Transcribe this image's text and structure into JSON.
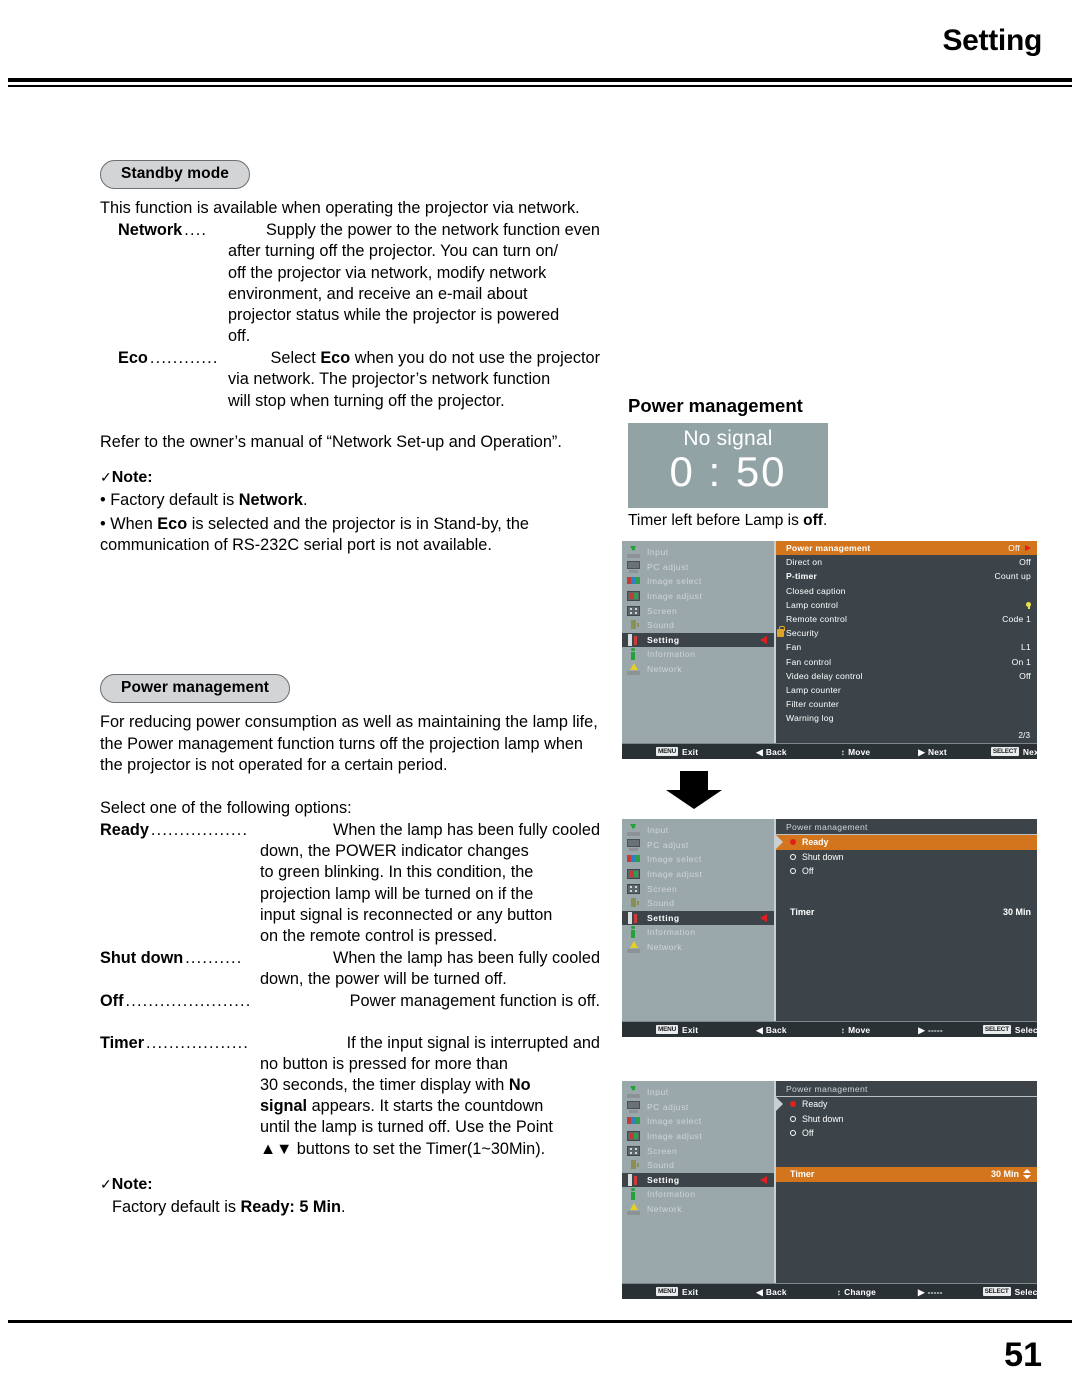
{
  "header": {
    "title": "Setting"
  },
  "footer": {
    "page_number": "51"
  },
  "left_column": {
    "standby": {
      "pill_label": "Standby mode",
      "intro": "This function is available when operating the projector via network.",
      "definitions": [
        {
          "term": "Network",
          "leader": "....",
          "lines": [
            "Supply the power to the network function even",
            "after turning off the projector. You can turn on/",
            "off the projector via network, modify network",
            "environment, and receive an e-mail about",
            "projector status while the projector is powered",
            "off."
          ]
        },
        {
          "term": "Eco",
          "leader": "............",
          "lines": [
            "Select Eco when you do not use the projector",
            "via network. The projector’s network function",
            "will stop when turning off the projector."
          ]
        }
      ],
      "refer": "Refer to the owner’s manual of “Network Set-up and Operation”.",
      "note_label": "Note:",
      "note_check": "✓",
      "notes": [
        "Factory default is Network.",
        "When Eco is selected and the projector is in Stand-by, the communication of RS-232C serial port is not available."
      ]
    },
    "power_management": {
      "pill_label": "Power management",
      "intro": "For reducing power consumption as well as maintaining the lamp life, the Power management function turns off the projection lamp when the projector is not operated for a certain period.",
      "select_line": "Select one of the following options:",
      "definitions": [
        {
          "term": "Ready",
          "leader": ".................",
          "lines": [
            "When the lamp has been fully cooled",
            "down, the POWER indicator changes",
            "to green blinking. In this condition, the",
            "projection lamp will be turned on if the",
            "input signal is reconnected or any button",
            "on the remote control is pressed."
          ]
        },
        {
          "term": "Shut down",
          "leader": "..........",
          "lines": [
            "When the lamp has been fully cooled",
            "down, the power will be turned off."
          ]
        },
        {
          "term": "Off",
          "leader": "......................",
          "lines": [
            "Power management function is off."
          ]
        },
        {
          "term": "Timer",
          "leader": "..................",
          "lines": [
            "If the input signal is interrupted and",
            "no button is pressed for more than",
            "30 seconds, the timer display with No",
            "signal appears. It starts the countdown",
            "until the lamp is turned off. Use the Point",
            "▲▼ buttons to set the Timer(1~30Min)."
          ]
        }
      ],
      "note_label": "Note:",
      "note_check": "✓",
      "note_text": "Factory default is Ready: 5 Min."
    }
  },
  "right_column": {
    "title": "Power management",
    "no_signal_panel": {
      "label": "No signal",
      "timer": "0 : 50",
      "background_color": "#92a3a5"
    },
    "caption": "Timer left before Lamp is off.",
    "sidebar_items": [
      {
        "label": "Input",
        "icon": "input-icon",
        "active": false
      },
      {
        "label": "PC adjust",
        "icon": "pc-adjust-icon",
        "active": false
      },
      {
        "label": "Image select",
        "icon": "image-select-icon",
        "active": false
      },
      {
        "label": "Image adjust",
        "icon": "image-adjust-icon",
        "active": false
      },
      {
        "label": "Screen",
        "icon": "screen-icon",
        "active": false
      },
      {
        "label": "Sound",
        "icon": "sound-icon",
        "active": false
      },
      {
        "label": "Setting",
        "icon": "setting-icon",
        "active": true
      },
      {
        "label": "Information",
        "icon": "information-icon",
        "active": false
      },
      {
        "label": "Network",
        "icon": "network-icon",
        "active": false
      }
    ],
    "menu1": {
      "rows": [
        {
          "label": "Power management",
          "value": "Off",
          "highlight": true,
          "arrow": true
        },
        {
          "label": "Direct on",
          "value": "Off"
        },
        {
          "label": "P-timer",
          "value": "Count  up"
        },
        {
          "label": "Closed caption",
          "value": ""
        },
        {
          "label": "Lamp control",
          "value": "",
          "lamp_dot": true
        },
        {
          "label": "Remote control",
          "value": "Code 1"
        },
        {
          "label": "Security",
          "value": "",
          "lock": true
        },
        {
          "label": "Fan",
          "value": "L1"
        },
        {
          "label": "Fan control",
          "value": "On 1"
        },
        {
          "label": "Video delay control",
          "value": "Off"
        },
        {
          "label": "Lamp counter",
          "value": ""
        },
        {
          "label": "Filter counter",
          "value": ""
        },
        {
          "label": "Warning log",
          "value": ""
        }
      ],
      "page_indicator": "2/3",
      "bar": [
        {
          "key": "MENU",
          "text": "Exit"
        },
        {
          "glyph": "◀",
          "text": "Back"
        },
        {
          "glyph": "↕",
          "text": "Move"
        },
        {
          "glyph": "▶",
          "text": "Next"
        },
        {
          "key": "SELECT",
          "text": "Next"
        }
      ]
    },
    "menu2": {
      "sub_title": "Power management",
      "options": [
        {
          "label": "Ready",
          "selected": true,
          "highlight": true
        },
        {
          "label": "Shut down",
          "selected": false,
          "highlight": false
        },
        {
          "label": "Off",
          "selected": false,
          "highlight": false
        }
      ],
      "timer": {
        "label": "Timer",
        "value": "30 Min",
        "highlight": false,
        "stepper": false
      },
      "bar": [
        {
          "key": "MENU",
          "text": "Exit"
        },
        {
          "glyph": "◀",
          "text": "Back"
        },
        {
          "glyph": "↕",
          "text": "Move"
        },
        {
          "glyph": "▶",
          "text": "-----"
        },
        {
          "key": "SELECT",
          "text": "Select"
        }
      ]
    },
    "menu3": {
      "sub_title": "Power management",
      "options": [
        {
          "label": "Ready",
          "selected": true,
          "highlight": false
        },
        {
          "label": "Shut down",
          "selected": false,
          "highlight": false
        },
        {
          "label": "Off",
          "selected": false,
          "highlight": false
        }
      ],
      "timer": {
        "label": "Timer",
        "value": "30 Min",
        "highlight": true,
        "stepper": true
      },
      "bar": [
        {
          "key": "MENU",
          "text": "Exit"
        },
        {
          "glyph": "◀",
          "text": "Back"
        },
        {
          "glyph": "↕",
          "text": "Change"
        },
        {
          "glyph": "▶",
          "text": "-----"
        },
        {
          "key": "SELECT",
          "text": "Select"
        }
      ]
    },
    "colors": {
      "highlight": "#d2751c",
      "menu_bg": "#3c4449",
      "sidebar_bg": "#9aa7ab",
      "bar_bg": "#2a3135",
      "accent_red": "#e02020"
    }
  }
}
